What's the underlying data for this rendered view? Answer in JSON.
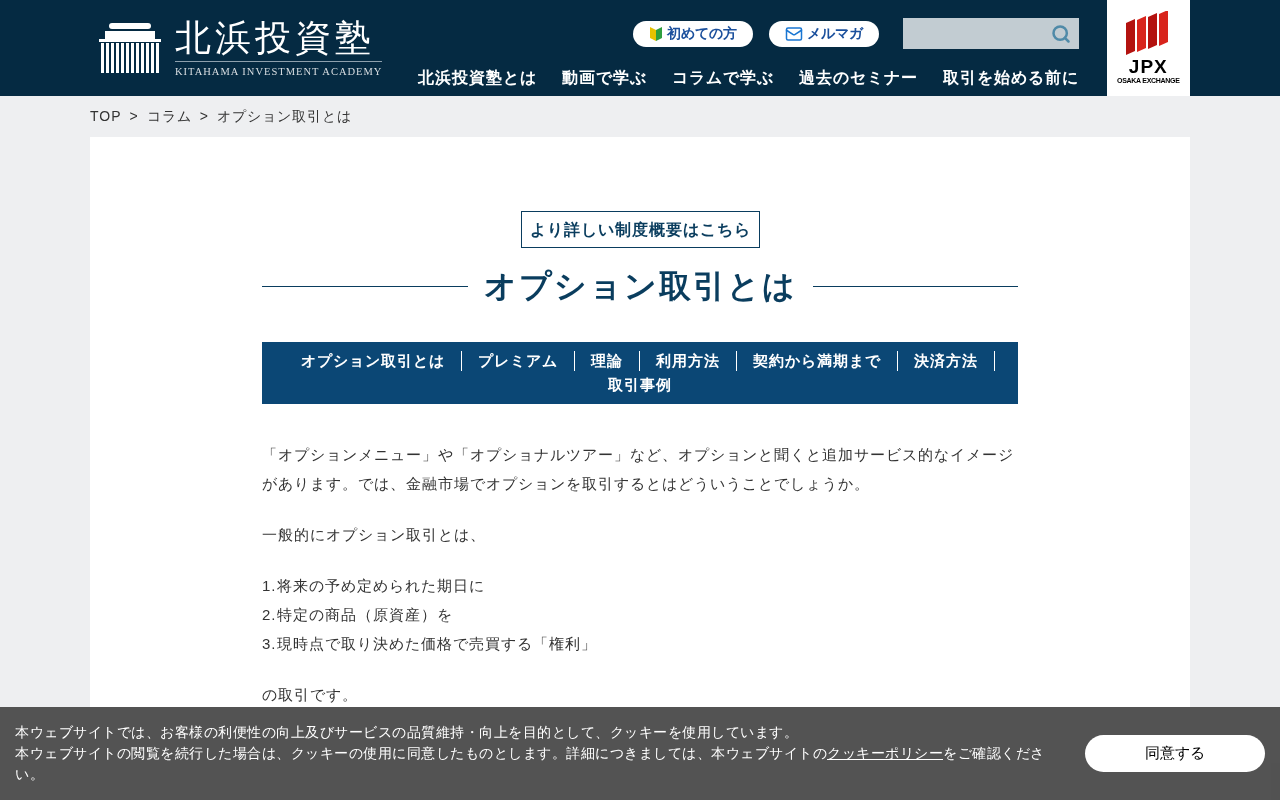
{
  "header": {
    "logo": {
      "title": "北浜投資塾",
      "subtitle": "KITAHAMA INVESTMENT ACADEMY"
    },
    "quick_links": [
      {
        "kind": "beginner",
        "label": "初めての方"
      },
      {
        "kind": "mail",
        "label": "メルマガ"
      }
    ],
    "nav": [
      "北浜投資塾とは",
      "動画で学ぶ",
      "コラムで学ぶ",
      "過去のセミナー",
      "取引を始める前に"
    ],
    "partner_logo": {
      "title": "JPX",
      "subtitle": "OSAKA EXCHANGE"
    }
  },
  "breadcrumb": [
    "TOP",
    "コラム",
    "オプション取引とは"
  ],
  "breadcrumb_separator": ">",
  "article": {
    "detail_link": "より詳しい制度概要はこちら",
    "title": "オプション取引とは",
    "toc": [
      "オプション取引とは",
      "プレミアム",
      "理論",
      "利用方法",
      "契約から満期まで",
      "決済方法",
      "取引事例"
    ],
    "paragraphs": [
      [
        "「オプションメニュー」や「オプショナルツアー」など、オプションと聞くと追加サービス的なイメージがあります。では、金融市場でオプションを取引するとはどういうことでしょうか。"
      ],
      [
        "一般的にオプション取引とは、"
      ],
      [
        "1.将来の予め定められた期日に",
        "2.特定の商品（原資産）を",
        "3.現時点で取り決めた価格で売買する「権利」"
      ],
      [
        "の取引です。"
      ]
    ]
  },
  "cookie_banner": {
    "lines": [
      "本ウェブサイトでは、お客様の利便性の向上及びサービスの品質維持・向上を目的として、クッキーを使用しています。",
      "本ウェブサイトの閲覧を続行した場合は、クッキーの使用に同意したものとします。詳細につきましては、本ウェブサイトの"
    ],
    "link": "クッキーポリシー",
    "after_link": "をご確認ください。",
    "button": "同意する"
  }
}
